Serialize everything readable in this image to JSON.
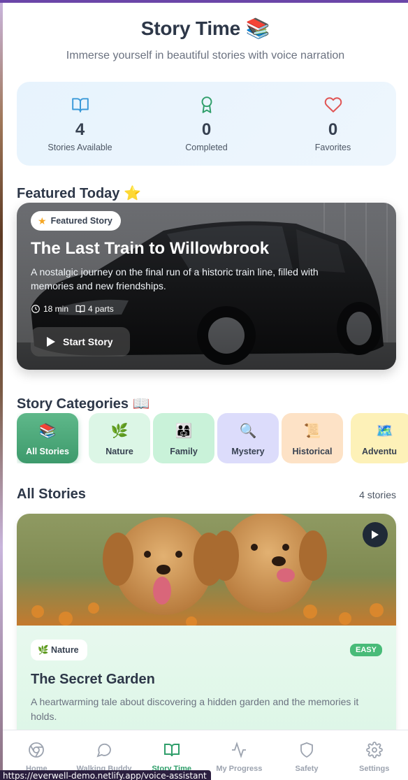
{
  "header": {
    "title": "Story Time 📚",
    "subtitle": "Immerse yourself in beautiful stories with voice narration"
  },
  "stats": [
    {
      "icon": "book-open-icon",
      "value": "4",
      "label": "Stories Available",
      "color": "#3b9ad9"
    },
    {
      "icon": "award-icon",
      "value": "0",
      "label": "Completed",
      "color": "#2f9e6a"
    },
    {
      "icon": "heart-icon",
      "value": "0",
      "label": "Favorites",
      "color": "#e05555"
    }
  ],
  "featured": {
    "section_title": "Featured Today ⭐",
    "badge": "Featured Story",
    "title": "The Last Train to Willowbrook",
    "description": "A nostalgic journey on the final run of a historic train line, filled with memories and new friendships.",
    "duration": "18 min",
    "parts": "4 parts",
    "start_label": "Start Story"
  },
  "categories": {
    "section_title": "Story Categories 📖",
    "items": [
      {
        "emoji": "📚",
        "label": "All Stories",
        "active": true
      },
      {
        "emoji": "🌿",
        "label": "Nature"
      },
      {
        "emoji": "👨‍👩‍👧",
        "label": "Family"
      },
      {
        "emoji": "🔍",
        "label": "Mystery"
      },
      {
        "emoji": "📜",
        "label": "Historical"
      },
      {
        "emoji": "🗺️",
        "label": "Adventu"
      }
    ]
  },
  "all_stories": {
    "section_title": "All Stories",
    "count": "4 stories",
    "items": [
      {
        "category": "🌿 Nature",
        "difficulty": "EASY",
        "title": "The Secret Garden",
        "description": "A heartwarming tale about discovering a hidden garden and the memories it holds."
      }
    ]
  },
  "nav": [
    {
      "icon": "chrome-icon",
      "label": "Home"
    },
    {
      "icon": "message-circle-icon",
      "label": "Walking Buddy"
    },
    {
      "icon": "book-open-icon",
      "label": "Story Time",
      "active": true
    },
    {
      "icon": "activity-icon",
      "label": "My Progress"
    },
    {
      "icon": "shield-icon",
      "label": "Safety"
    },
    {
      "icon": "gear-icon",
      "label": "Settings"
    }
  ],
  "status_url": "https://everwell-demo.netlify.app/voice-assistant"
}
